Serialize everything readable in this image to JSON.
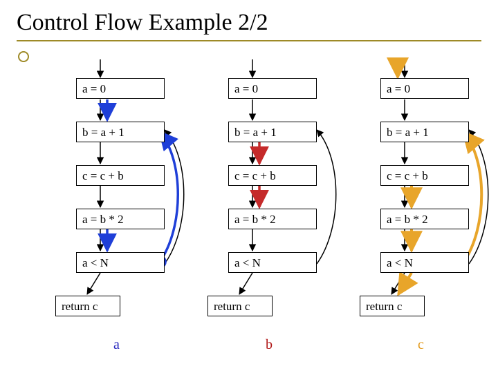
{
  "title": "Control Flow Example 2/2",
  "labels": {
    "a": "a",
    "b": "b",
    "c": "c"
  },
  "stmts": {
    "s1": "a = 0",
    "s2": "b = a + 1",
    "s3": "c = c + b",
    "s4": "a = b * 2",
    "s5": "a < N",
    "ret": "return c"
  },
  "colors": {
    "blue": "#1f3fd8",
    "red": "#c52a2a",
    "orange": "#e8a52a",
    "olive": "#9e8a27",
    "black": "#000000"
  },
  "chart_data": {
    "type": "table",
    "title": "Control Flow Example 2/2",
    "columns": [
      "a",
      "b",
      "c"
    ],
    "nodes": [
      "a = 0",
      "b = a + 1",
      "c = c + b",
      "a = b * 2",
      "a < N",
      "return c"
    ],
    "forward_edges": [
      [
        "entry",
        "a = 0"
      ],
      [
        "a = 0",
        "b = a + 1"
      ],
      [
        "b = a + 1",
        "c = c + b"
      ],
      [
        "c = c + b",
        "a = b * 2"
      ],
      [
        "a = b * 2",
        "a < N"
      ],
      [
        "a < N",
        "return c"
      ]
    ],
    "back_edge": [
      "a < N",
      "b = a + 1"
    ],
    "highlights": {
      "a": {
        "color": "blue",
        "edges": [
          [
            "a = 0",
            "b = a + 1"
          ],
          [
            "a = b * 2",
            "a < N"
          ],
          [
            "a < N",
            "b = a + 1"
          ]
        ]
      },
      "b": {
        "color": "red",
        "edges": [
          [
            "b = a + 1",
            "c = c + b"
          ],
          [
            "c = c + b",
            "a = b * 2"
          ]
        ]
      },
      "c": {
        "color": "orange",
        "edges": [
          [
            "entry",
            "a = 0"
          ],
          [
            "c = c + b",
            "a = b * 2"
          ],
          [
            "a = b * 2",
            "a < N"
          ],
          [
            "a < N",
            "return c"
          ],
          [
            "a < N",
            "b = a + 1"
          ]
        ]
      }
    }
  }
}
